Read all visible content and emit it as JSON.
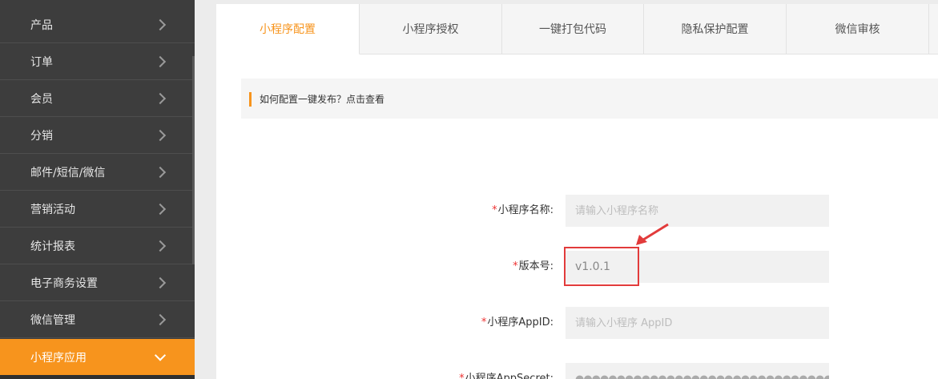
{
  "sidebar": {
    "items": [
      {
        "label": "产品"
      },
      {
        "label": "订单"
      },
      {
        "label": "会员"
      },
      {
        "label": "分销"
      },
      {
        "label": "邮件/短信/微信"
      },
      {
        "label": "营销活动"
      },
      {
        "label": "统计报表"
      },
      {
        "label": "电子商务设置"
      },
      {
        "label": "微信管理"
      },
      {
        "label": "小程序应用",
        "active": true
      }
    ]
  },
  "tabs": [
    {
      "label": "小程序配置",
      "active": true
    },
    {
      "label": "小程序授权"
    },
    {
      "label": "一键打包代码"
    },
    {
      "label": "隐私保护配置"
    },
    {
      "label": "微信审核"
    }
  ],
  "notice": {
    "text": "如何配置一键发布？点击查看"
  },
  "form": {
    "required_mark": "*",
    "fields": [
      {
        "label": "小程序名称:",
        "placeholder": "请输入小程序名称",
        "value": ""
      },
      {
        "label": "版本号:",
        "placeholder": "",
        "value": "v1.0.1"
      },
      {
        "label": "小程序AppID:",
        "placeholder": "请输入小程序 AppID",
        "value": ""
      },
      {
        "label": "小程序AppSecret:",
        "placeholder": "",
        "value": "●●●●●●●●●●●●●●●●●●●●●●●●●●●●●●●●"
      }
    ]
  },
  "colors": {
    "accent": "#f7941d",
    "sidebar_bg": "#3d3d3d",
    "annotation": "#e23b3b"
  }
}
